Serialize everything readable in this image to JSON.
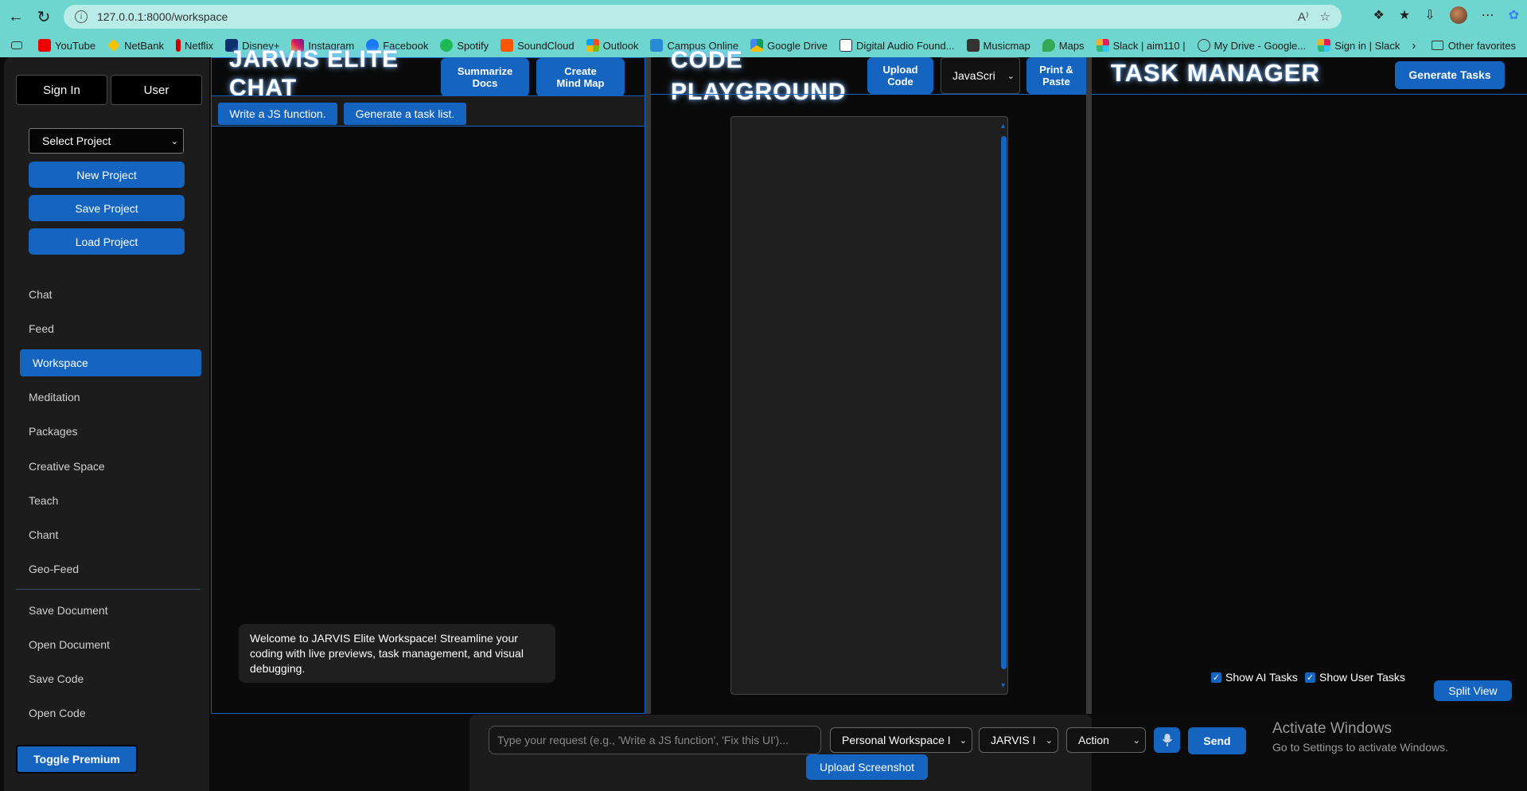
{
  "browser": {
    "url": "127.0.0.1:8000/workspace",
    "bookmarks": [
      "YouTube",
      "NetBank",
      "Netflix",
      "Disney+",
      "Instagram",
      "Facebook",
      "Spotify",
      "SoundCloud",
      "Outlook",
      "Campus Online",
      "Google Drive",
      "Digital Audio Found...",
      "Musicmap",
      "Maps",
      "Slack | aim110 |",
      "My Drive - Google...",
      "Sign in | Slack"
    ],
    "other_favorites": "Other favorites"
  },
  "sidebar": {
    "sign_in": "Sign In",
    "user": "User",
    "select_project": "Select Project",
    "new_project": "New Project",
    "save_project": "Save Project",
    "load_project": "Load Project",
    "nav": [
      "Chat",
      "Feed",
      "Workspace",
      "Meditation",
      "Packages",
      "Creative Space",
      "Teach",
      "Chant",
      "Geo-Feed"
    ],
    "active": "Workspace",
    "doc_nav": [
      "Save Document",
      "Open Document",
      "Save Code",
      "Open Code"
    ],
    "toggle_premium": "Toggle Premium"
  },
  "chat": {
    "title_line1": "JARVIS ELITE",
    "title_line2": "CHAT",
    "summarize_line1": "Summarize",
    "summarize_line2": "Docs",
    "mindmap_line1": "Create",
    "mindmap_line2": "Mind Map",
    "suggestions": [
      "Write a JS function.",
      "Generate a task list."
    ],
    "welcome": "Welcome to JARVIS Elite Workspace! Streamline your coding with live previews, task management, and visual debugging."
  },
  "code": {
    "title_line1": "CODE",
    "title_line2": "PLAYGROUND",
    "upload_line1": "Upload",
    "upload_line2": "Code",
    "language": "JavaScri",
    "print_line1": "Print &",
    "print_line2": "Paste"
  },
  "tasks": {
    "title": "TASK MANAGER",
    "generate": "Generate Tasks",
    "show_ai": "Show AI Tasks",
    "show_user": "Show User Tasks",
    "split_view": "Split View"
  },
  "input": {
    "placeholder": "Type your request (e.g., 'Write a JS function', 'Fix this UI')...",
    "workspace_select": "Personal Workspace I",
    "model_select": "JARVIS I",
    "action_select": "Action",
    "send": "Send",
    "upload_screenshot": "Upload Screenshot"
  },
  "os": {
    "activate_title": "Activate Windows",
    "activate_sub": "Go to Settings to activate Windows."
  },
  "colors": {
    "accent": "#1565c0",
    "chrome": "#6fd6cf",
    "sidebar": "#1c1c1c",
    "bg": "#0a0a0a"
  }
}
